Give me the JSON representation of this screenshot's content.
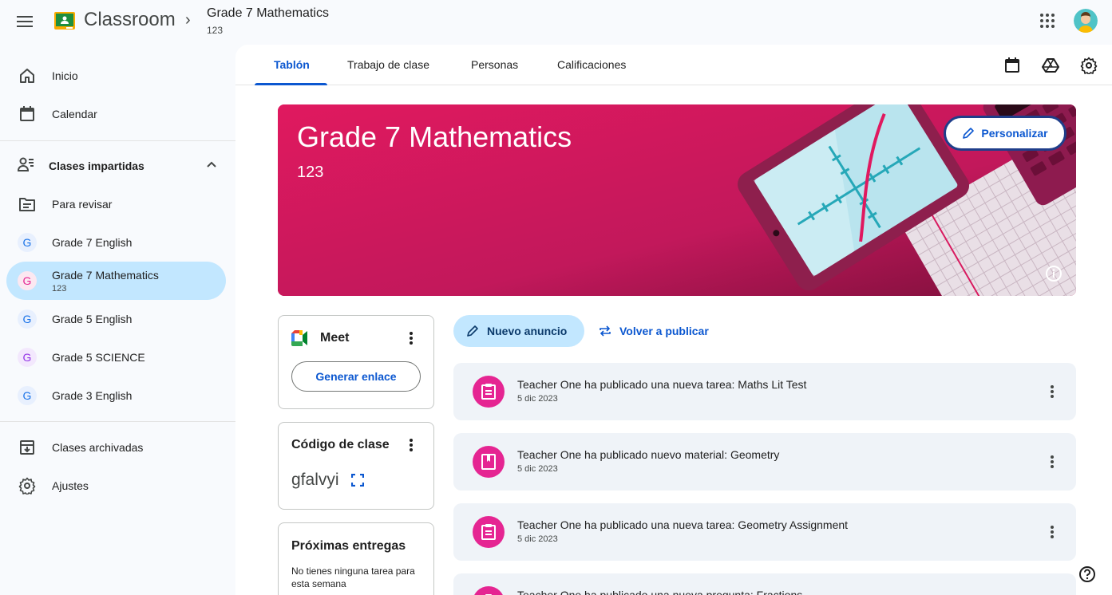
{
  "header": {
    "app_name": "Classroom",
    "breadcrumb_sep": "›",
    "class_title": "Grade 7 Mathematics",
    "class_section": "123"
  },
  "sidebar": {
    "home": "Inicio",
    "calendar": "Calendar",
    "teaching_section": "Clases impartidas",
    "to_review": "Para revisar",
    "classes": [
      {
        "initial": "G",
        "label": "Grade 7 English",
        "color": "#1a73e8"
      },
      {
        "initial": "G",
        "label": "Grade 7 Mathematics",
        "sub": "123",
        "color": "#e52592"
      },
      {
        "initial": "G",
        "label": "Grade 5 English",
        "color": "#1a73e8"
      },
      {
        "initial": "G",
        "label": "Grade 5 SCIENCE",
        "color": "#9334e6"
      },
      {
        "initial": "G",
        "label": "Grade 3 English",
        "color": "#1a73e8"
      }
    ],
    "archived": "Clases archivadas",
    "settings": "Ajustes"
  },
  "tabs": [
    "Tablón",
    "Trabajo de clase",
    "Personas",
    "Calificaciones"
  ],
  "banner": {
    "title": "Grade 7 Mathematics",
    "subtitle": "123",
    "customize": "Personalizar",
    "color": "#d81b60"
  },
  "meet": {
    "title": "Meet",
    "generate_link": "Generar enlace"
  },
  "class_code": {
    "title": "Código de clase",
    "code": "gfalvyi"
  },
  "upcoming": {
    "title": "Próximas entregas",
    "empty": "No tienes ninguna tarea para esta semana"
  },
  "stream": {
    "new_announcement": "Nuevo anuncio",
    "repost": "Volver a publicar",
    "posts": [
      {
        "title": "Teacher One ha publicado una nueva tarea: Maths Lit Test",
        "date": "5 dic 2023",
        "icon": "assignment-icon"
      },
      {
        "title": "Teacher One ha publicado nuevo material: Geometry",
        "date": "5 dic 2023",
        "icon": "material-icon"
      },
      {
        "title": "Teacher One ha publicado una nueva tarea: Geometry Assignment",
        "date": "5 dic 2023",
        "icon": "assignment-icon"
      },
      {
        "title": "Teacher One ha publicado una nueva pregunta: Fractions",
        "date": "",
        "icon": "assignment-icon"
      }
    ]
  },
  "colors": {
    "accent": "#0b57d0",
    "active_bg": "#c2e7ff",
    "post_icon": "#e52592"
  }
}
